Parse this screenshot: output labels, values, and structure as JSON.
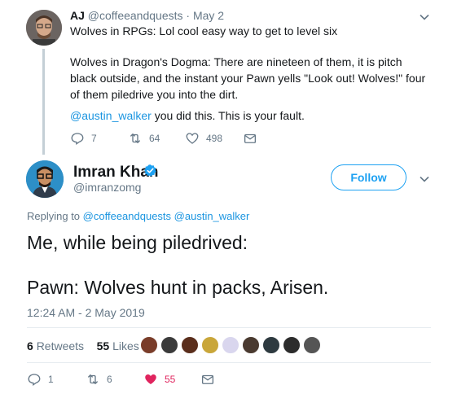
{
  "quoted_tweet": {
    "author_name": "AJ",
    "author_handle": "@coffeeandquests",
    "separator": "·",
    "date": "May 2",
    "line1": "Wolves in RPGs: Lol cool easy way to get to level six",
    "para2": "Wolves in Dragon's Dogma: There are nineteen of them, it is pitch black outside, and the instant your Pawn yells \"Look out! Wolves!\" four of them piledrive you into the dirt.",
    "mention": "@austin_walker",
    "para3_rest": " you did this. This is your fault.",
    "actions": {
      "replies": "7",
      "retweets": "64",
      "likes": "498"
    }
  },
  "main_tweet": {
    "author_name": "Imran Khan",
    "author_handle": "@imranzomg",
    "follow_label": "Follow",
    "replying_label": "Replying to",
    "replying_to": [
      "@coffeeandquests",
      "@austin_walker"
    ],
    "text_line1": "Me, while being piledrived:",
    "text_line2": "Pawn: Wolves hunt in packs, Arisen.",
    "timestamp": "12:24 AM - 2 May 2019",
    "stats": {
      "retweets_count": "6",
      "retweets_label": "Retweets",
      "likes_count": "55",
      "likes_label": "Likes"
    },
    "likers": [
      "#7a3d2a",
      "#3b3b3b",
      "#5a2e1c",
      "#c9a63a",
      "#d9d6ee",
      "#4a3a30",
      "#2e3a40",
      "#2c2c2c",
      "#555555"
    ],
    "actions": {
      "replies": "1",
      "retweets": "6",
      "likes": "55"
    }
  },
  "colors": {
    "accent": "#1da1f2",
    "like": "#e0245e",
    "muted": "#657786"
  }
}
